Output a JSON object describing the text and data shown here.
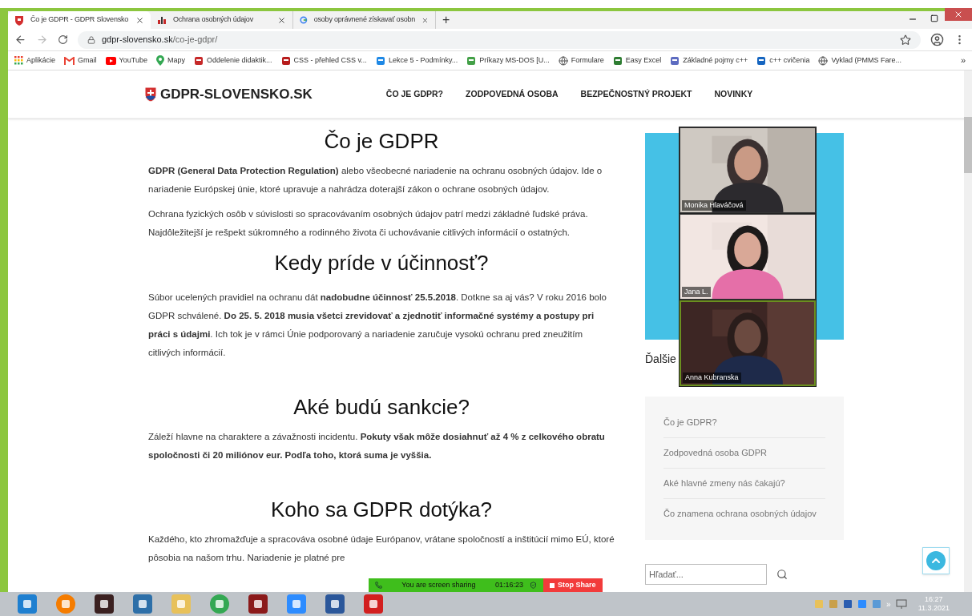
{
  "tabs": [
    {
      "title": "Čo je GDPR - GDPR Slovensko",
      "selected": true,
      "kind": "shield"
    },
    {
      "title": "Ochrana osobných údajov",
      "selected": false,
      "kind": "sk"
    },
    {
      "title": "osoby oprávnené získavať osobn",
      "selected": false,
      "kind": "google"
    }
  ],
  "new_tab": "+",
  "address": {
    "host": "gdpr-slovensko.sk",
    "path": "/co-je-gdpr/"
  },
  "bookmarks": [
    {
      "label": "Aplikácie",
      "kind": "apps"
    },
    {
      "label": "Gmail",
      "kind": "gmail"
    },
    {
      "label": "YouTube",
      "kind": "youtube"
    },
    {
      "label": "Mapy",
      "kind": "maps"
    },
    {
      "label": "Oddelenie didaktik...",
      "kind": "di"
    },
    {
      "label": "CSS - přehled CSS v...",
      "kind": "doc"
    },
    {
      "label": "Lekce 5 - Podmínky...",
      "kind": "laptop"
    },
    {
      "label": "Príkazy MS-DOS [U...",
      "kind": "pen"
    },
    {
      "label": "Formulare",
      "kind": "globe"
    },
    {
      "label": "Easy Excel",
      "kind": "excel"
    },
    {
      "label": "Základné pojmy c++",
      "kind": "doc2"
    },
    {
      "label": "c++ cvičenia",
      "kind": "drop"
    },
    {
      "label": "Vyklad (PMMS Fare...",
      "kind": "globe"
    }
  ],
  "bookmarks_more": "»",
  "site": {
    "logo": "GDPR-SLOVENSKO.SK",
    "nav": [
      "ČO JE GDPR?",
      "ZODPOVEDNÁ OSOBA",
      "BEZPEČNOSTNÝ PROJEKT",
      "NOVINKY"
    ]
  },
  "article": [
    {
      "heading": "Čo je GDPR",
      "paragraphs": [
        "**GDPR (General Data Protection Regulation)** alebo všeobecné nariadenie na ochranu osobných údajov. Ide o nariadenie Európskej únie, ktoré upravuje a nahrádza doterajší zákon o ochrane osobných údajov.",
        "Ochrana fyzických osôb v súvislosti so spracovávaním osobných údajov patrí medzi základné ľudské práva. Najdôležitejší je rešpekt súkromného a rodinného života či uchovávanie citlivých informácií o ostatných."
      ]
    },
    {
      "heading": "Kedy príde v účinnosť?",
      "paragraphs": [
        "Súbor ucelených pravidiel na ochranu dát **nadobudne účinnosť 25.5.2018**. Dotkne sa aj vás? V roku 2016 bolo GDPR schválené. **Do 25. 5. 2018 musia všetci zrevidovať a zjednotiť informačné systémy a postupy pri práci s údajmi**. Ich tok je v rámci Únie podporovaný a nariadenie zaručuje vysokú ochranu pred zneužitím citlivých informácií."
      ]
    },
    {
      "heading": "Aké budú sankcie?",
      "paragraphs": [
        "Záleží hlavne na charaktere a závažnosti incidentu. **Pokuty však môže dosiahnuť až 4 % z celkového obratu spoločnosti či 20 miliónov eur. Podľa toho, ktorá suma je vyššia.**"
      ]
    },
    {
      "heading": "Koho sa GDPR dotýka?",
      "paragraphs": [
        "Každého, kto zhromažďuje a spracováva osobné údaje Európanov, vrátane spoločností a inštitúcií mimo EÚ, ktoré pôsobia na našom trhu. Nariadenie je platné pre"
      ]
    }
  ],
  "sidebar": {
    "heading": "Ďalšie",
    "links": [
      "Čo je GDPR?",
      "Zodpovedná osoba GDPR",
      "Aké hlavné zmeny nás čakajú?",
      "Čo znamena ochrana osobných údajov"
    ],
    "search": {
      "placeholder": "Hľadať..."
    }
  },
  "video_tiles": [
    {
      "name": "Monika Hlaváčová",
      "speaking": false
    },
    {
      "name": "Jana L.",
      "speaking": false
    },
    {
      "name": "Anna Kubranska",
      "speaking": true
    }
  ],
  "share_bar": {
    "status": "You are screen sharing",
    "timer": "01:16:23",
    "stop": "Stop Share"
  },
  "taskbar": {
    "time": "16:27",
    "date": "11.3.2021",
    "overflow": "»"
  }
}
